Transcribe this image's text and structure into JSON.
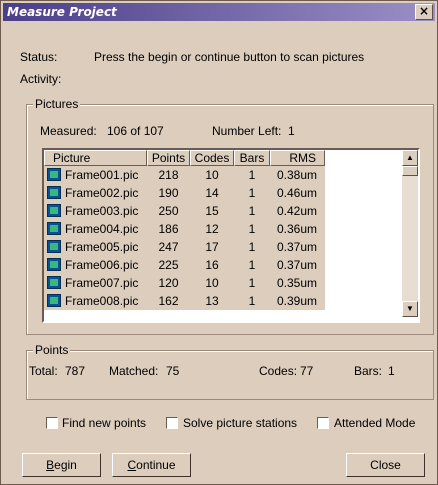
{
  "window": {
    "title": "Measure Project",
    "close_glyph": "×"
  },
  "status": {
    "label": "Status:",
    "text": "Press the begin or continue button to scan pictures"
  },
  "activity": {
    "label": "Activity:"
  },
  "pictures": {
    "group_title": "Pictures",
    "measured_label": "Measured:",
    "measured_value": "106 of 107",
    "number_left_label": "Number Left:",
    "number_left_value": "1",
    "columns": [
      "Picture",
      "Points",
      "Codes",
      "Bars",
      "RMS"
    ],
    "rows": [
      {
        "name": "Frame001.pic",
        "points": "218",
        "codes": "10",
        "bars": "1",
        "rms": "0.38um"
      },
      {
        "name": "Frame002.pic",
        "points": "190",
        "codes": "14",
        "bars": "1",
        "rms": "0.46um"
      },
      {
        "name": "Frame003.pic",
        "points": "250",
        "codes": "15",
        "bars": "1",
        "rms": "0.42um"
      },
      {
        "name": "Frame004.pic",
        "points": "186",
        "codes": "12",
        "bars": "1",
        "rms": "0.36um"
      },
      {
        "name": "Frame005.pic",
        "points": "247",
        "codes": "17",
        "bars": "1",
        "rms": "0.37um"
      },
      {
        "name": "Frame006.pic",
        "points": "225",
        "codes": "16",
        "bars": "1",
        "rms": "0.37um"
      },
      {
        "name": "Frame007.pic",
        "points": "120",
        "codes": "10",
        "bars": "1",
        "rms": "0.35um"
      },
      {
        "name": "Frame008.pic",
        "points": "162",
        "codes": "13",
        "bars": "1",
        "rms": "0.39um"
      }
    ],
    "row_icon": "picture-file-icon"
  },
  "points": {
    "group_title": "Points",
    "total_label": "Total:",
    "total_value": "787",
    "matched_label": "Matched:",
    "matched_value": "75",
    "codes_label": "Codes:",
    "codes_value": "77",
    "bars_label": "Bars:",
    "bars_value": "1"
  },
  "options": {
    "find_new_points": {
      "label": "Find new points",
      "checked": false
    },
    "solve_picture_stations": {
      "label": "Solve picture stations",
      "checked": false
    },
    "attended_mode": {
      "label": "Attended Mode",
      "checked": false
    }
  },
  "buttons": {
    "begin_mnemonic": "B",
    "begin_rest": "egin",
    "continue_mnemonic": "C",
    "continue_rest": "ontinue",
    "close": "Close"
  },
  "colors": {
    "dialog_bg": "#dccdbd",
    "title_start": "#4a3f88",
    "title_end": "#9b8fc6",
    "icon_blue": "#0a4f9a",
    "icon_green": "#37b87c"
  }
}
